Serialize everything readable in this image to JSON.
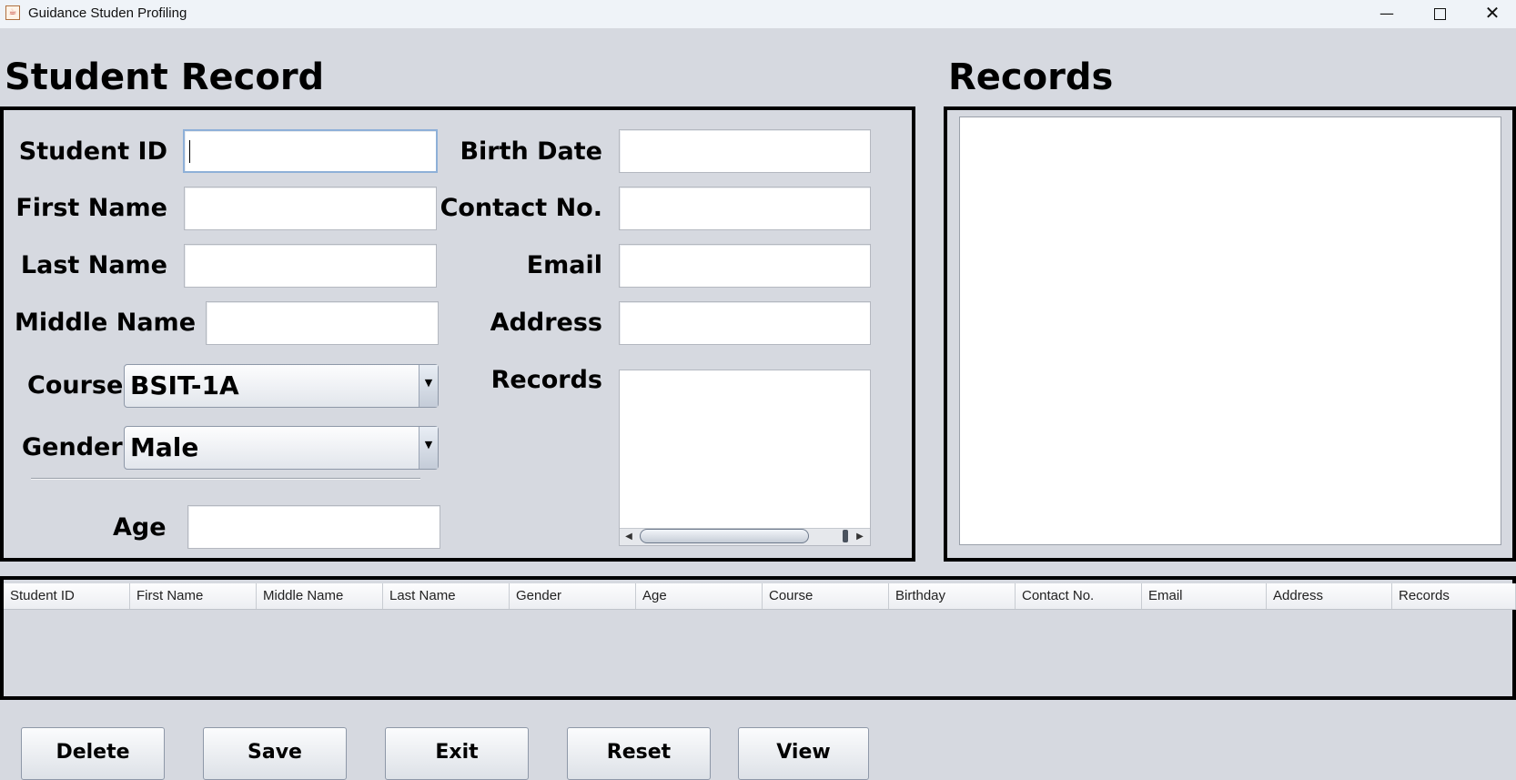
{
  "window": {
    "title": "Guidance Studen Profiling",
    "min_glyph": "—",
    "close_glyph": "✕",
    "app_icon_glyph": "☕"
  },
  "headings": {
    "student_record": "Student Record",
    "records": "Records"
  },
  "form": {
    "student_id": {
      "label": "Student ID",
      "value": ""
    },
    "first_name": {
      "label": "First Name",
      "value": ""
    },
    "last_name": {
      "label": "Last Name",
      "value": ""
    },
    "middle_name": {
      "label": "Middle Name",
      "value": ""
    },
    "course": {
      "label": "Course",
      "value": "BSIT-1A"
    },
    "gender": {
      "label": "Gender",
      "value": "Male"
    },
    "age": {
      "label": "Age",
      "value": ""
    },
    "birth_date": {
      "label": "Birth Date",
      "value": ""
    },
    "contact_no": {
      "label": "Contact No.",
      "value": ""
    },
    "email": {
      "label": "Email",
      "value": ""
    },
    "address": {
      "label": "Address",
      "value": ""
    },
    "records": {
      "label": "Records",
      "value": ""
    }
  },
  "table": {
    "columns": [
      "Student ID",
      "First Name",
      "Middle Name",
      "Last Name",
      "Gender",
      "Age",
      "Course",
      "Birthday",
      "Contact No.",
      "Email",
      "Address",
      "Records"
    ],
    "rows": []
  },
  "buttons": {
    "delete": "Delete",
    "save": "Save",
    "exit": "Exit",
    "reset": "Reset",
    "view": "View"
  },
  "icons": {
    "dropdown": "chevron-down-icon",
    "scroll_left": "arrow-left-icon",
    "scroll_right": "arrow-right-icon"
  }
}
